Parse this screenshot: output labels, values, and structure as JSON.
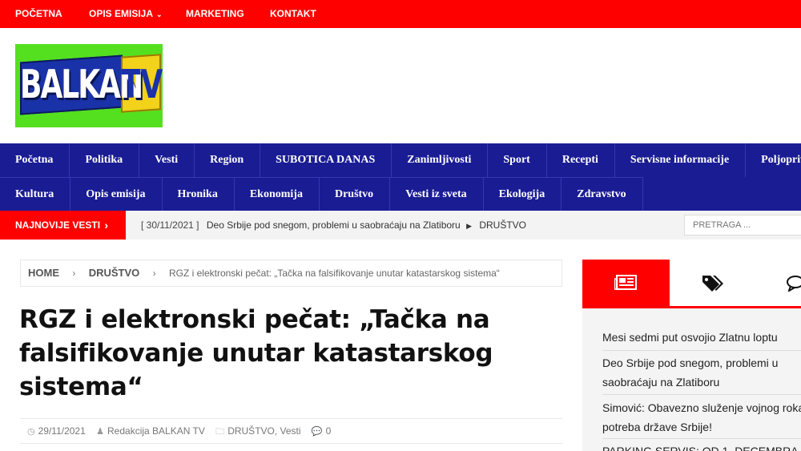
{
  "topbar": {
    "home": "Početna",
    "opis_emisija": "Opis emisija",
    "marketing": "Marketing",
    "kontakt": "Kontakt"
  },
  "logo": {
    "text": "BALKAN",
    "tv": "TV"
  },
  "mainnav": {
    "row1": [
      "Početna",
      "Politika",
      "Vesti",
      "Region",
      "SUBOTICA DANAS",
      "Zanimljivosti",
      "Sport",
      "Recepti",
      "Servisne informacije",
      "Poljoprivreda"
    ],
    "row2": [
      "Kultura",
      "Opis emisija",
      "Hronika",
      "Ekonomija",
      "Društvo",
      "Vesti iz sveta",
      "Ekologija",
      "Zdravstvo"
    ]
  },
  "breaking": {
    "label": "Najnovije vesti",
    "date": "[ 30/11/2021 ]",
    "headline": "Deo Srbije pod snegom, problemi u saobraćaju na Zlatiboru",
    "category": "DRUŠTVO"
  },
  "search": {
    "placeholder": "PRETRAGA ..."
  },
  "breadcrumb": {
    "home": "Home",
    "section": "DRUŠTVO",
    "current": "RGZ i elektronski pečat: „Tačka na falsifikovanje unutar katastarskog sistema“"
  },
  "article": {
    "title": "RGZ i elektronski pečat: „Tačka na falsifikovanje unutar katastarskog sistema“",
    "date": "29/11/2021",
    "author": "Redakcija BALKAN TV",
    "categories": "DRUŠTVO",
    "category_sep": ", ",
    "category2": "Vesti",
    "comments": "0"
  },
  "sidebar": {
    "items": [
      "Mesi sedmi put osvojio Zlatnu loptu",
      "Deo Srbije pod snegom, problemi u saobraćaju na Zlatiboru",
      "Simović: Obavezno služenje vojnog roka potreba države Srbije!",
      "PARKING SERVIS: OD 1. DECEMBRA"
    ]
  },
  "colors": {
    "accent_red": "#ff0000",
    "nav_blue": "#1a1c94",
    "logo_green": "#54e01e",
    "logo_blue": "#1a32a8",
    "logo_yellow": "#f2d21a"
  }
}
